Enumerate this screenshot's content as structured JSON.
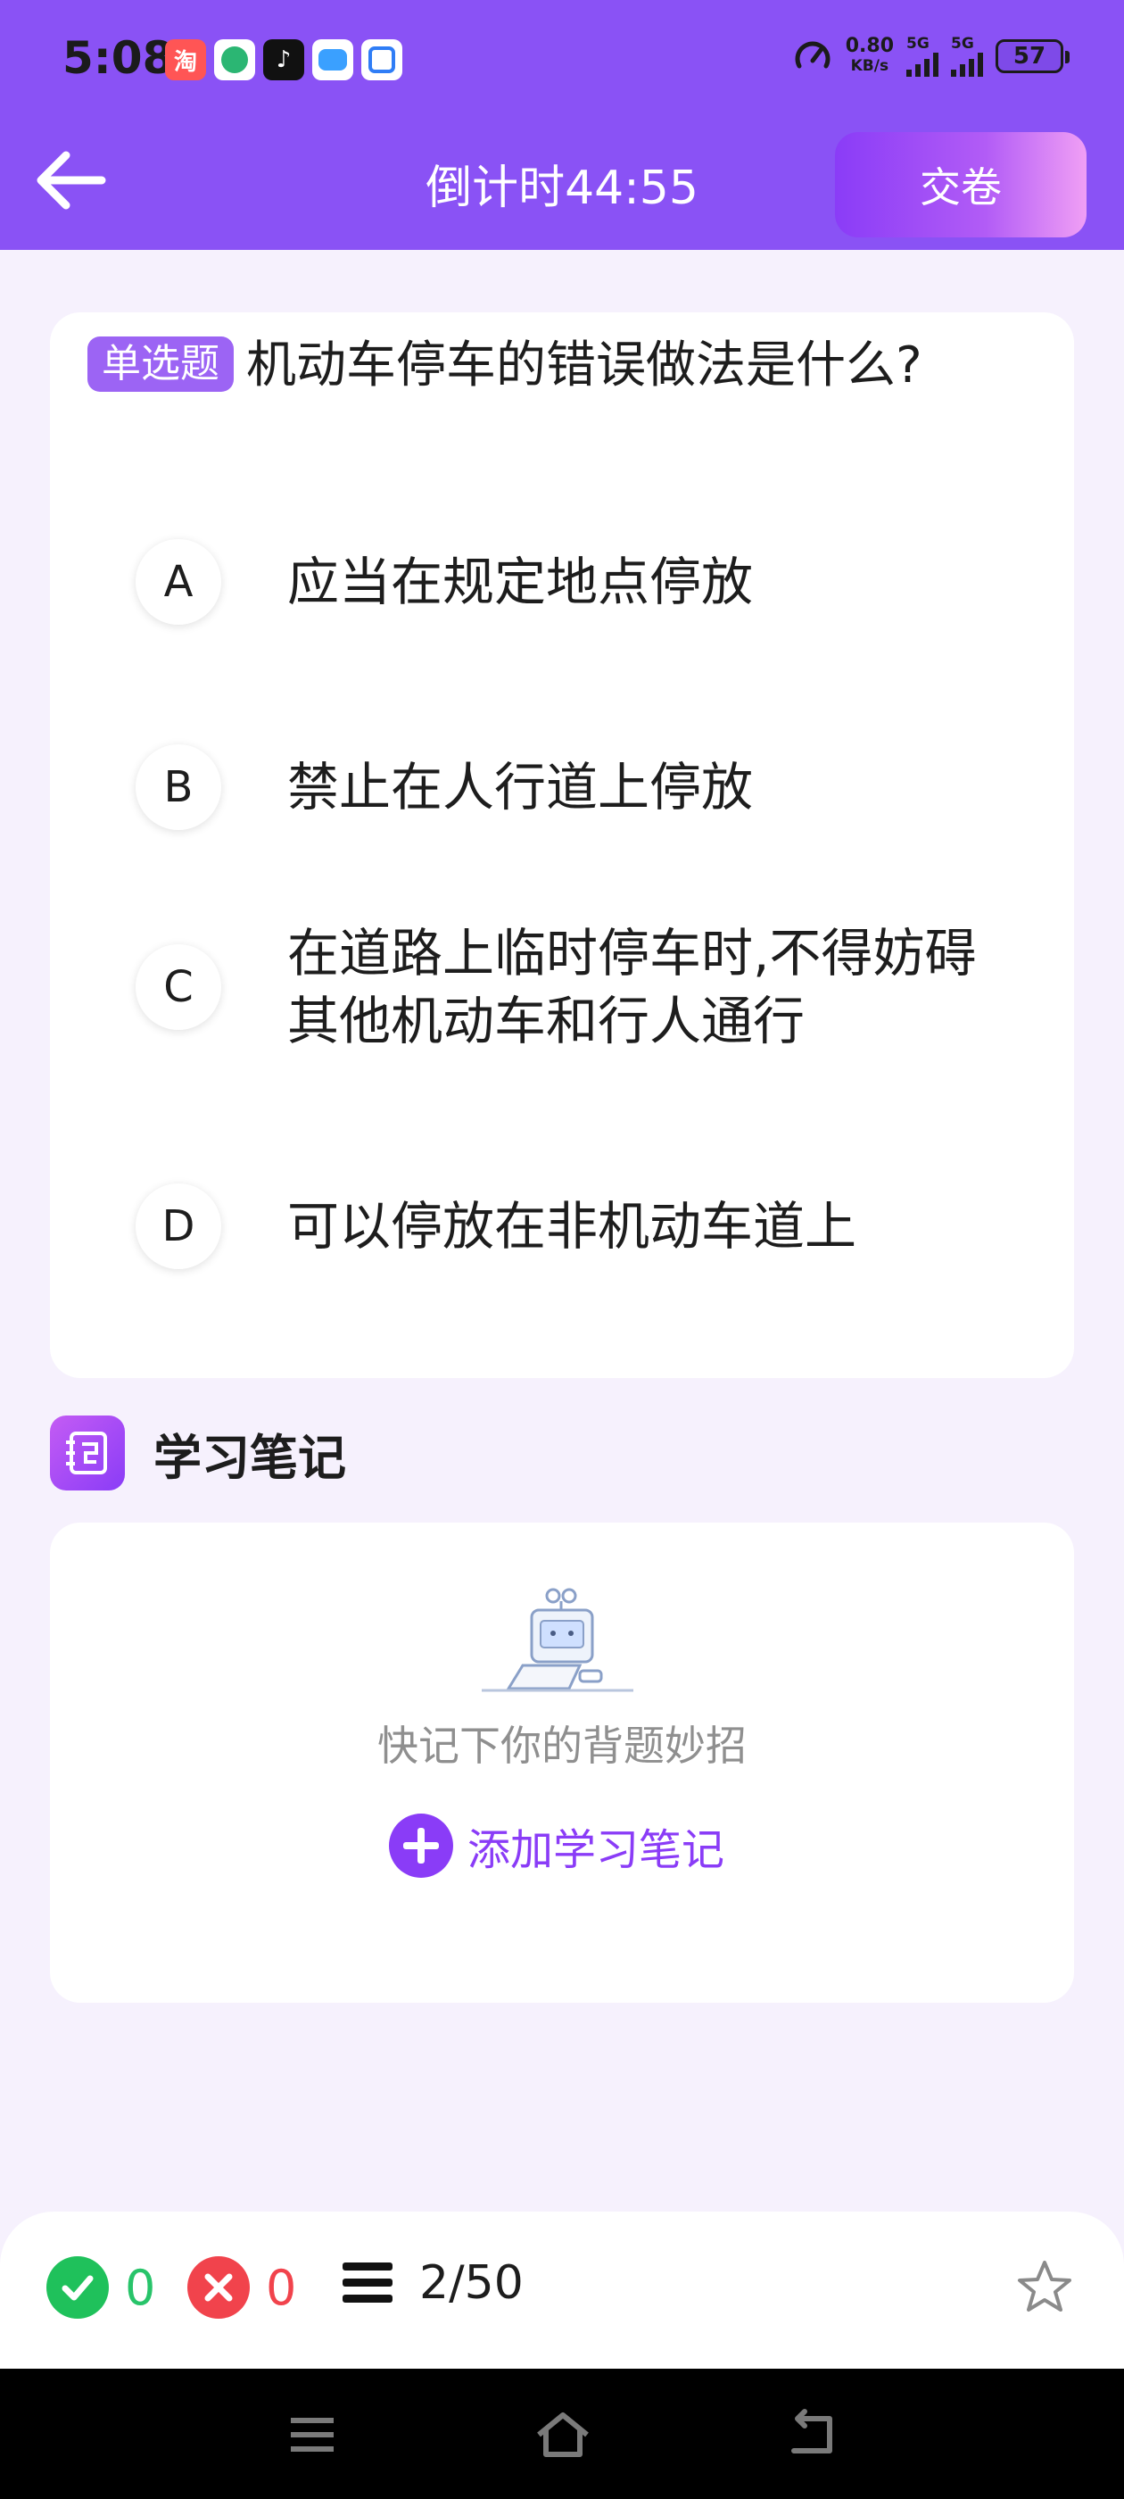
{
  "status_bar": {
    "time": "5:08",
    "net_speed_value": "0.80",
    "net_speed_unit": "KB/s",
    "signal1_label": "5G",
    "signal2_label": "5G",
    "battery": "57"
  },
  "header": {
    "timer": "倒计时44:55",
    "submit_label": "交卷",
    "bg_color": "#8a52f5"
  },
  "question": {
    "type_badge": "单选题",
    "text": "机动车停车的错误做法是什么?",
    "options": [
      {
        "letter": "A",
        "text": "应当在规定地点停放"
      },
      {
        "letter": "B",
        "text": "禁止在人行道上停放"
      },
      {
        "letter": "C",
        "text": "在道路上临时停车时,不得妨碍其他机动车和行人通行"
      },
      {
        "letter": "D",
        "text": "可以停放在非机动车道上"
      }
    ]
  },
  "notes": {
    "title": "学习笔记",
    "empty_text": "快记下你的背题妙招",
    "add_label": "添加学习笔记"
  },
  "bottom": {
    "correct_count": "0",
    "wrong_count": "0",
    "progress": "2/50",
    "correct_color": "#1fc15b",
    "wrong_color": "#f1434c"
  }
}
